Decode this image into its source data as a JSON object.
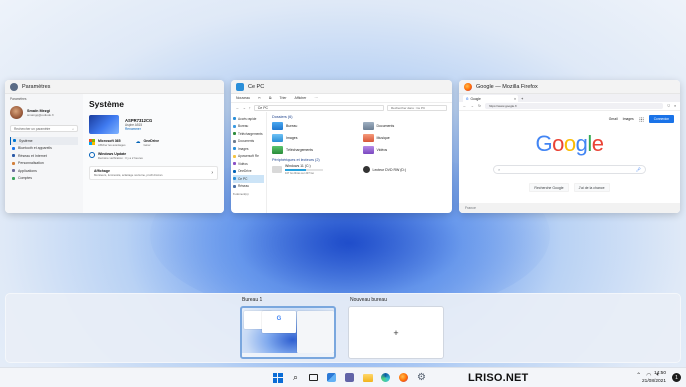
{
  "windows": {
    "settings": {
      "title": "Paramètres",
      "back_label": "Paramètres",
      "user_name": "Smaïn Mezgi",
      "user_email": "smaingq@outlook.fr",
      "search_placeholder": "Rechercher un paramètre",
      "nav": [
        "Système",
        "Bluetooth et appareils",
        "Réseau et Internet",
        "Personnalisation",
        "Applications",
        "Comptes"
      ],
      "page_title": "Système",
      "device_name": "ASPR7312CG",
      "device_model": "Aspire A515",
      "device_rename": "Renommer",
      "m365_title": "Microsoft 365",
      "m365_sub": "Afficher les avantages",
      "onedrive_title": "OneDrive",
      "onedrive_sub": "Gérer",
      "update_title": "Windows Update",
      "update_sub": "Dernière vérification : Il y a 2 heures",
      "display_title": "Affichage",
      "display_sub": "Moniteurs, luminosité, éclairage nocturne, profil d'écran"
    },
    "explorer": {
      "title": "Ce PC",
      "new_label": "Nouveau",
      "view_label": "Trier",
      "more_label": "Afficher",
      "address": "Ce PC",
      "search_placeholder": "Rechercher dans : Ce PC",
      "sidebar": [
        "Accès rapide",
        "Bureau",
        "Téléchargements",
        "Documents",
        "Images",
        "Apowersoft Re",
        "Vidéos",
        "OneDrive",
        "Ce PC",
        "Réseau"
      ],
      "status": "8 élément(s)",
      "group_folders": "Dossiers (6)",
      "folders": [
        "Bureau",
        "Documents",
        "Images",
        "Musique",
        "Téléchargements",
        "Vidéos"
      ],
      "group_drives": "Périphériques et lecteurs (2)",
      "drives": [
        {
          "name": "Windows 11 (C:)",
          "free": "107 Go libres sur 237 Go",
          "used": 0.55
        },
        {
          "name": "Lecteur DVD RW (D:)",
          "free": "",
          "used": 0
        }
      ]
    },
    "firefox": {
      "title": "Google — Mozilla Firefox",
      "tab_label": "Google",
      "url": "https://www.google.fr",
      "gmail": "Gmail",
      "images": "Images",
      "signin": "Connexion",
      "logo_letters": [
        "G",
        "o",
        "o",
        "g",
        "l",
        "e"
      ],
      "btn_search": "Recherche Google",
      "btn_lucky": "J'ai de la chance",
      "footer": "France"
    }
  },
  "desktops": {
    "desk1_label": "Bureau 1",
    "desk2_label": "Nouveau bureau",
    "add_symbol": "+"
  },
  "taskbar": {
    "brand": "LRISO.NET",
    "time": "14:50",
    "date": "21/08/2021",
    "notifications": "1"
  },
  "colors": {
    "accent": "#005fb8",
    "google_blue": "#4285f4",
    "google_red": "#ea4335",
    "google_yellow": "#fbbc05",
    "google_green": "#34a853",
    "folder_yellow": "#f5c542"
  }
}
